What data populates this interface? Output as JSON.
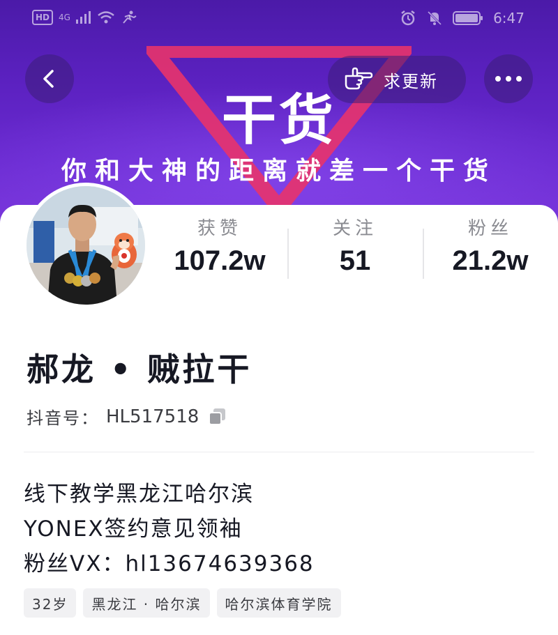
{
  "status_bar": {
    "left_badges": [
      "HD",
      "4G"
    ],
    "time": "6:47"
  },
  "banner": {
    "title": "干货",
    "subtitle": "你和大神的距离就差一个干货",
    "colors": {
      "background": "#5b21c0",
      "triangle": "#e8336b"
    }
  },
  "header": {
    "back_icon": "chevron-left-icon",
    "update_button_icon": "pointing-hand-icon",
    "update_button_label": "求更新",
    "more_icon": "more-dots-icon"
  },
  "profile": {
    "stats": [
      {
        "label": "获赞",
        "value": "107.2w"
      },
      {
        "label": "关注",
        "value": "51"
      },
      {
        "label": "粉丝",
        "value": "21.2w"
      }
    ],
    "nickname": "郝龙 • 贼拉干",
    "douyin_id_label": "抖音号：",
    "douyin_id": "HL517518",
    "bio_lines": [
      "线下教学黑龙江哈尔滨",
      "YONEX签约意见领袖",
      "粉丝VX：hl13674639368"
    ],
    "tags": [
      "32岁",
      "黑龙江 · 哈尔滨",
      "哈尔滨体育学院"
    ]
  }
}
